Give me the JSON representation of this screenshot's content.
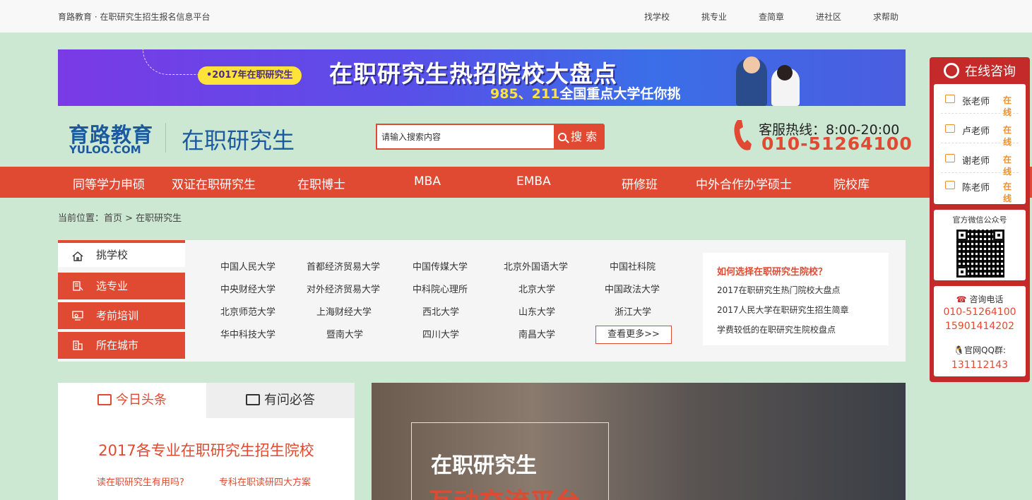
{
  "topbar": {
    "slogan": "育路教育 · 在职研究生招生报名信息平台",
    "links": [
      "找学校",
      "挑专业",
      "查简章",
      "进社区",
      "求帮助"
    ]
  },
  "banner": {
    "pill": "•2017年在职研究生",
    "headline": "在职研究生热招院校大盘点",
    "sub_highlight": "985、211",
    "sub_rest": "全国重点大学任你挑"
  },
  "header": {
    "logo_main": "育路教育",
    "logo_sub": "YULOO.COM",
    "site_name": "在职研究生",
    "search_placeholder": "请输入搜索内容",
    "search_button": "搜 索",
    "hotline_label": "客服热线：8:00-20:00",
    "hotline_number": "010-51264100"
  },
  "nav": [
    "同等学力申硕",
    "双证在职研究生",
    "在职博士",
    "MBA",
    "EMBA",
    "研修班",
    "中外合作办学硕士",
    "院校库"
  ],
  "breadcrumb": "当前位置：首页 > 在职研究生",
  "side_tabs": [
    "挑学校",
    "选专业",
    "考前培训",
    "所在城市"
  ],
  "schools": [
    [
      "中国人民大学",
      "首都经济贸易大学",
      "中国传媒大学",
      "北京外国语大学",
      "中国社科院"
    ],
    [
      "中央财经大学",
      "对外经济贸易大学",
      "中科院心理所",
      "北京大学",
      "中国政法大学"
    ],
    [
      "北京师范大学",
      "上海财经大学",
      "西北大学",
      "山东大学",
      "浙江大学"
    ],
    [
      "华中科技大学",
      "暨南大学",
      "四川大学",
      "南昌大学"
    ]
  ],
  "more_button": "查看更多>>",
  "articles": {
    "heading": "如何选择在职研究生院校？",
    "items": [
      "2017在职研究生热门院校大盘点",
      "2017人民大学在职研究生招生简章",
      "学费较低的在职研究生院校盘点"
    ]
  },
  "news": {
    "tab_today": "今日头条",
    "tab_qa": "有问必答",
    "headline": "2017各专业在职研究生招生院校",
    "link1": "读在职研究生有用吗?",
    "link2": "专科在职读研四大方案"
  },
  "promo": {
    "title": "在职研究生",
    "subtitle": "互动交流平台"
  },
  "float_panel": {
    "title": "在线咨询",
    "teachers": [
      {
        "name": "张老师",
        "status": "在线"
      },
      {
        "name": "卢老师",
        "status": "在线"
      },
      {
        "name": "谢老师",
        "status": "在线"
      },
      {
        "name": "陈老师",
        "status": "在线"
      }
    ],
    "wechat_label": "官方微信公众号",
    "phone_label": "咨询电话",
    "phone1": "010-51264100",
    "phone2": "15901414202",
    "qq_label": "官网QQ群:",
    "qq_number": "131112143"
  },
  "colors": {
    "brand_red": "#e04a32",
    "brand_blue": "#1c5aa0",
    "page_bg": "#cce8d2",
    "float_red": "#c52a2a",
    "online_orange": "#f0902c"
  }
}
